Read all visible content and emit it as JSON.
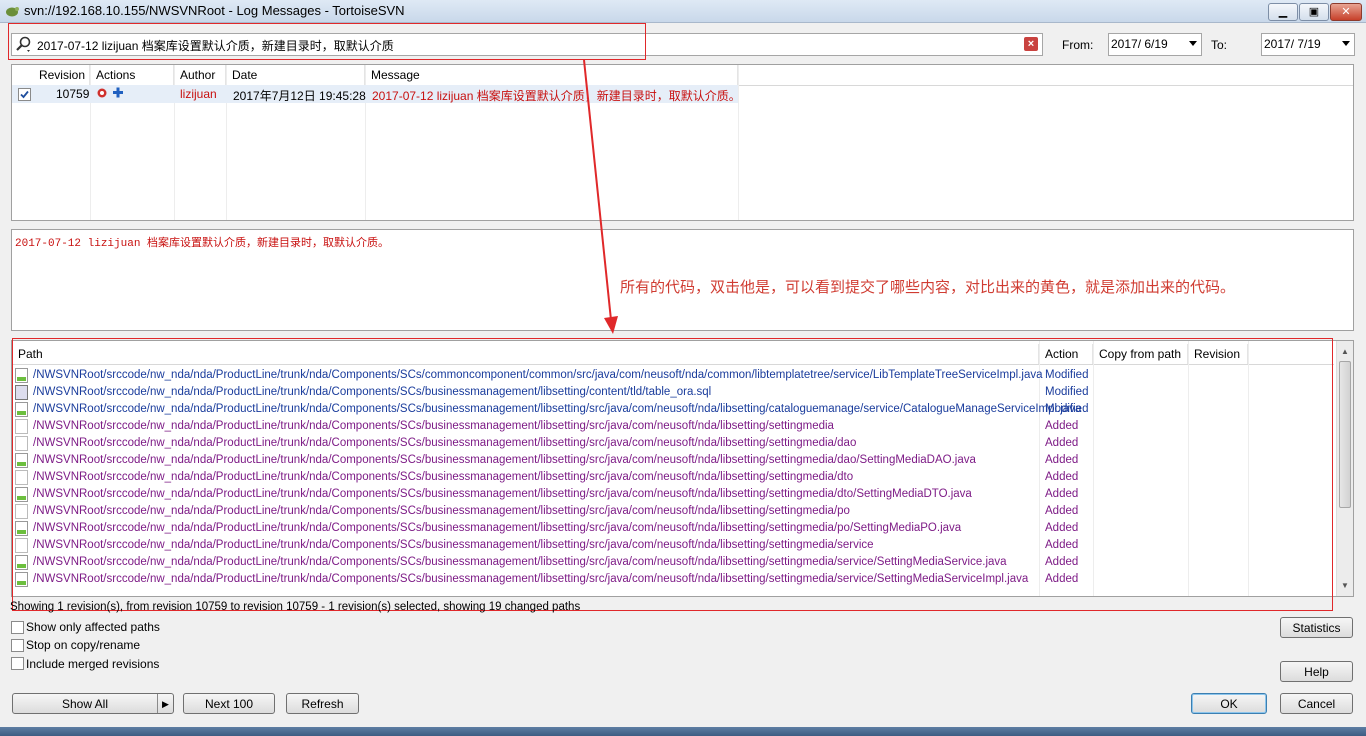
{
  "window": {
    "title": "svn://192.168.10.155/NWSVNRoot - Log Messages - TortoiseSVN"
  },
  "search": {
    "value": "2017-07-12 lizijuan 档案库设置默认介质，新建目录时，取默认介质"
  },
  "dates": {
    "from_label": "From:",
    "from_value": "2017/ 6/19",
    "to_label": "To:",
    "to_value": "2017/ 7/19"
  },
  "log_table": {
    "headers": [
      "Revision",
      "Actions",
      "Author",
      "Date",
      "Message"
    ],
    "rows": [
      {
        "revision": "10759",
        "author": "lizijuan",
        "date": "2017年7月12日 19:45:28",
        "message": "2017-07-12 lizijuan 档案库设置默认介质，新建目录时，取默认介质。"
      }
    ]
  },
  "message_panel": {
    "text": "2017-07-12 lizijuan 档案库设置默认介质，新建目录时，取默认介质。",
    "annotation": "所有的代码，双击他是，可以看到提交了哪些内容，对比出来的黄色，就是添加出来的代码。"
  },
  "paths_table": {
    "headers": [
      "Path",
      "Action",
      "Copy from path",
      "Revision"
    ],
    "rows": [
      {
        "icon": "java-file-icon",
        "path": "/NWSVNRoot/srccode/nw_nda/nda/ProductLine/trunk/nda/Components/SCs/commoncomponent/common/src/java/com/neusoft/nda/common/libtemplatetree/service/LibTemplateTreeServiceImpl.java",
        "action": "Modified"
      },
      {
        "icon": "sql-file-icon",
        "path": "/NWSVNRoot/srccode/nw_nda/nda/ProductLine/trunk/nda/Components/SCs/businessmanagement/libsetting/content/tld/table_ora.sql",
        "action": "Modified"
      },
      {
        "icon": "java-file-icon",
        "path": "/NWSVNRoot/srccode/nw_nda/nda/ProductLine/trunk/nda/Components/SCs/businessmanagement/libsetting/src/java/com/neusoft/nda/libsetting/cataloguemanage/service/CatalogueManageServiceImpl.java",
        "action": "Modified"
      },
      {
        "icon": "folder-icon",
        "path": "/NWSVNRoot/srccode/nw_nda/nda/ProductLine/trunk/nda/Components/SCs/businessmanagement/libsetting/src/java/com/neusoft/nda/libsetting/settingmedia",
        "action": "Added"
      },
      {
        "icon": "folder-icon",
        "path": "/NWSVNRoot/srccode/nw_nda/nda/ProductLine/trunk/nda/Components/SCs/businessmanagement/libsetting/src/java/com/neusoft/nda/libsetting/settingmedia/dao",
        "action": "Added"
      },
      {
        "icon": "java-file-icon",
        "path": "/NWSVNRoot/srccode/nw_nda/nda/ProductLine/trunk/nda/Components/SCs/businessmanagement/libsetting/src/java/com/neusoft/nda/libsetting/settingmedia/dao/SettingMediaDAO.java",
        "action": "Added"
      },
      {
        "icon": "folder-icon",
        "path": "/NWSVNRoot/srccode/nw_nda/nda/ProductLine/trunk/nda/Components/SCs/businessmanagement/libsetting/src/java/com/neusoft/nda/libsetting/settingmedia/dto",
        "action": "Added"
      },
      {
        "icon": "java-file-icon",
        "path": "/NWSVNRoot/srccode/nw_nda/nda/ProductLine/trunk/nda/Components/SCs/businessmanagement/libsetting/src/java/com/neusoft/nda/libsetting/settingmedia/dto/SettingMediaDTO.java",
        "action": "Added"
      },
      {
        "icon": "folder-icon",
        "path": "/NWSVNRoot/srccode/nw_nda/nda/ProductLine/trunk/nda/Components/SCs/businessmanagement/libsetting/src/java/com/neusoft/nda/libsetting/settingmedia/po",
        "action": "Added"
      },
      {
        "icon": "java-file-icon",
        "path": "/NWSVNRoot/srccode/nw_nda/nda/ProductLine/trunk/nda/Components/SCs/businessmanagement/libsetting/src/java/com/neusoft/nda/libsetting/settingmedia/po/SettingMediaPO.java",
        "action": "Added"
      },
      {
        "icon": "folder-icon",
        "path": "/NWSVNRoot/srccode/nw_nda/nda/ProductLine/trunk/nda/Components/SCs/businessmanagement/libsetting/src/java/com/neusoft/nda/libsetting/settingmedia/service",
        "action": "Added"
      },
      {
        "icon": "java-file-icon",
        "path": "/NWSVNRoot/srccode/nw_nda/nda/ProductLine/trunk/nda/Components/SCs/businessmanagement/libsetting/src/java/com/neusoft/nda/libsetting/settingmedia/service/SettingMediaService.java",
        "action": "Added"
      },
      {
        "icon": "java-file-icon",
        "path": "/NWSVNRoot/srccode/nw_nda/nda/ProductLine/trunk/nda/Components/SCs/businessmanagement/libsetting/src/java/com/neusoft/nda/libsetting/settingmedia/service/SettingMediaServiceImpl.java",
        "action": "Added"
      }
    ]
  },
  "status": {
    "text": "Showing 1 revision(s), from revision 10759 to revision 10759 - 1 revision(s) selected, showing 19 changed paths"
  },
  "options": {
    "affected": "Show only affected paths",
    "stop_copy": "Stop on copy/rename",
    "merged": "Include merged revisions"
  },
  "buttons": {
    "show_all": "Show All",
    "next100": "Next 100",
    "refresh": "Refresh",
    "statistics": "Statistics",
    "help": "Help",
    "ok": "OK",
    "cancel": "Cancel"
  },
  "colors": {
    "accent_red": "#c8100f",
    "modified_blue": "#1a3c9c",
    "added_purple": "#7d1b86",
    "annotation_red": "#e0282a"
  }
}
